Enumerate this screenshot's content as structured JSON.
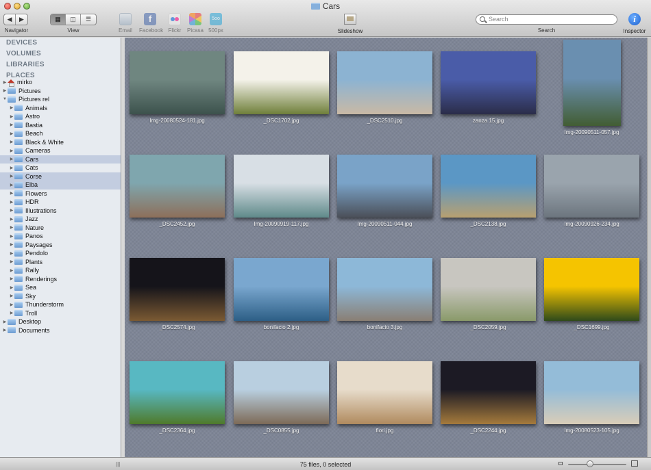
{
  "window": {
    "title": "Cars"
  },
  "toolbar": {
    "navigator_label": "Navigator",
    "view_label": "View",
    "share_items": [
      {
        "label": "Email",
        "icon": "email-icon"
      },
      {
        "label": "Facebook",
        "icon": "facebook-icon",
        "glyph": "f"
      },
      {
        "label": "Flickr",
        "icon": "flickr-icon"
      },
      {
        "label": "Picasa",
        "icon": "picasa-icon"
      },
      {
        "label": "500px",
        "icon": "500px-icon",
        "glyph": "5oo"
      }
    ],
    "slideshow_label": "Slideshow",
    "search_placeholder": "Search",
    "search_label": "Search",
    "inspector_label": "Inspector",
    "inspector_glyph": "i"
  },
  "sidebar": {
    "sections": [
      "DEVICES",
      "VOLUMES",
      "LIBRARIES",
      "PLACES"
    ],
    "tree": [
      {
        "label": "mirko",
        "depth": 0,
        "expanded": false,
        "icon": "home-icon",
        "selected": false
      },
      {
        "label": "Pictures",
        "depth": 0,
        "expanded": false,
        "icon": "folder-icon",
        "selected": false
      },
      {
        "label": "Pictures rel",
        "depth": 0,
        "expanded": true,
        "icon": "folder-icon",
        "selected": false
      },
      {
        "label": "Animals",
        "depth": 1,
        "expanded": false,
        "icon": "folder-icon",
        "selected": false
      },
      {
        "label": "Astro",
        "depth": 1,
        "expanded": false,
        "icon": "folder-icon",
        "selected": false
      },
      {
        "label": "Bastia",
        "depth": 1,
        "expanded": false,
        "icon": "folder-icon",
        "selected": false
      },
      {
        "label": "Beach",
        "depth": 1,
        "expanded": false,
        "icon": "folder-icon",
        "selected": false
      },
      {
        "label": "Black & White",
        "depth": 1,
        "expanded": false,
        "icon": "folder-icon",
        "selected": false
      },
      {
        "label": "Cameras",
        "depth": 1,
        "expanded": false,
        "icon": "folder-icon",
        "selected": false
      },
      {
        "label": "Cars",
        "depth": 1,
        "expanded": false,
        "icon": "folder-icon",
        "selected": true
      },
      {
        "label": "Cats",
        "depth": 1,
        "expanded": false,
        "icon": "folder-icon",
        "selected": false
      },
      {
        "label": "Corse",
        "depth": 1,
        "expanded": false,
        "icon": "folder-icon",
        "selected": true
      },
      {
        "label": "Elba",
        "depth": 1,
        "expanded": false,
        "icon": "folder-icon",
        "selected": true
      },
      {
        "label": "Flowers",
        "depth": 1,
        "expanded": false,
        "icon": "folder-icon",
        "selected": false
      },
      {
        "label": "HDR",
        "depth": 1,
        "expanded": false,
        "icon": "folder-icon",
        "selected": false
      },
      {
        "label": "Illustrations",
        "depth": 1,
        "expanded": false,
        "icon": "folder-icon",
        "selected": false
      },
      {
        "label": "Jazz",
        "depth": 1,
        "expanded": false,
        "icon": "folder-icon",
        "selected": false
      },
      {
        "label": "Nature",
        "depth": 1,
        "expanded": false,
        "icon": "folder-icon",
        "selected": false
      },
      {
        "label": "Panos",
        "depth": 1,
        "expanded": false,
        "icon": "folder-icon",
        "selected": false
      },
      {
        "label": "Paysages",
        "depth": 1,
        "expanded": false,
        "icon": "folder-icon",
        "selected": false
      },
      {
        "label": "Pendolo",
        "depth": 1,
        "expanded": false,
        "icon": "folder-icon",
        "selected": false
      },
      {
        "label": "Plants",
        "depth": 1,
        "expanded": false,
        "icon": "folder-icon",
        "selected": false
      },
      {
        "label": "Rally",
        "depth": 1,
        "expanded": false,
        "icon": "folder-icon",
        "selected": false
      },
      {
        "label": "Renderings",
        "depth": 1,
        "expanded": false,
        "icon": "folder-icon",
        "selected": false
      },
      {
        "label": "Sea",
        "depth": 1,
        "expanded": false,
        "icon": "folder-icon",
        "selected": false
      },
      {
        "label": "Sky",
        "depth": 1,
        "expanded": false,
        "icon": "folder-icon",
        "selected": false
      },
      {
        "label": "Thunderstorm",
        "depth": 1,
        "expanded": false,
        "icon": "folder-icon",
        "selected": false
      },
      {
        "label": "Troll",
        "depth": 1,
        "expanded": false,
        "icon": "folder-icon",
        "selected": false
      },
      {
        "label": "Desktop",
        "depth": 0,
        "expanded": false,
        "icon": "folder-icon",
        "selected": false
      },
      {
        "label": "Documents",
        "depth": 0,
        "expanded": false,
        "icon": "folder-icon",
        "selected": false
      }
    ]
  },
  "grid": {
    "items": [
      {
        "filename": "Img-20080524-181.jpg",
        "portrait": false,
        "colors": [
          "#6f8680",
          "#3d524d"
        ]
      },
      {
        "filename": "_DSC1702.jpg",
        "portrait": false,
        "colors": [
          "#f4f2ea",
          "#6f7f3a"
        ]
      },
      {
        "filename": "_DSC2510.jpg",
        "portrait": false,
        "colors": [
          "#8cb3d2",
          "#c9b9a5"
        ]
      },
      {
        "filename": "zanza 15.jpg",
        "portrait": false,
        "colors": [
          "#4a5ca8",
          "#2b2d49"
        ]
      },
      {
        "filename": "Img-20090511-057.jpg",
        "portrait": true,
        "colors": [
          "#6a8fb0",
          "#425d33"
        ]
      },
      {
        "filename": "_DSC2452.jpg",
        "portrait": false,
        "colors": [
          "#7fa6ae",
          "#8d6f5a"
        ]
      },
      {
        "filename": "Img-20090919-117.jpg",
        "portrait": false,
        "colors": [
          "#d8dfe5",
          "#5f8a8a"
        ]
      },
      {
        "filename": "Img-20090511-044.jpg",
        "portrait": false,
        "colors": [
          "#7aa3c8",
          "#4b4f58"
        ]
      },
      {
        "filename": "_DSC2138.jpg",
        "portrait": false,
        "colors": [
          "#5b97c5",
          "#b8a070"
        ]
      },
      {
        "filename": "Img-20090926-234.jpg",
        "portrait": false,
        "colors": [
          "#9aa4ad",
          "#6c757e"
        ]
      },
      {
        "filename": "_DSC2574.jpg",
        "portrait": false,
        "colors": [
          "#15141a",
          "#7b5a33"
        ]
      },
      {
        "filename": "bonifacio 2.jpg",
        "portrait": false,
        "colors": [
          "#7aa7cf",
          "#2d5f86"
        ]
      },
      {
        "filename": "bonifacio 3.jpg",
        "portrait": false,
        "colors": [
          "#8db8d8",
          "#8a7f74"
        ]
      },
      {
        "filename": "_DSC2059.jpg",
        "portrait": false,
        "colors": [
          "#c8c6c0",
          "#8a9a6a"
        ]
      },
      {
        "filename": "_DSC1699.jpg",
        "portrait": false,
        "colors": [
          "#f5c400",
          "#2f4a1a"
        ]
      },
      {
        "filename": "_DSC2364.jpg",
        "portrait": false,
        "colors": [
          "#58b8c2",
          "#4f7a2a"
        ]
      },
      {
        "filename": "_DSC0855.jpg",
        "portrait": false,
        "colors": [
          "#b9cfe0",
          "#7d6a57"
        ]
      },
      {
        "filename": "fiori.jpg",
        "portrait": false,
        "colors": [
          "#e7dccb",
          "#b08a5e"
        ]
      },
      {
        "filename": "_DSC2244.jpg",
        "portrait": false,
        "colors": [
          "#1c1a24",
          "#a67b3c"
        ]
      },
      {
        "filename": "Img-20080523-105.jpg",
        "portrait": false,
        "colors": [
          "#94bcd8",
          "#d9cdb8"
        ]
      }
    ]
  },
  "status": {
    "text": "75 files, 0 selected"
  }
}
